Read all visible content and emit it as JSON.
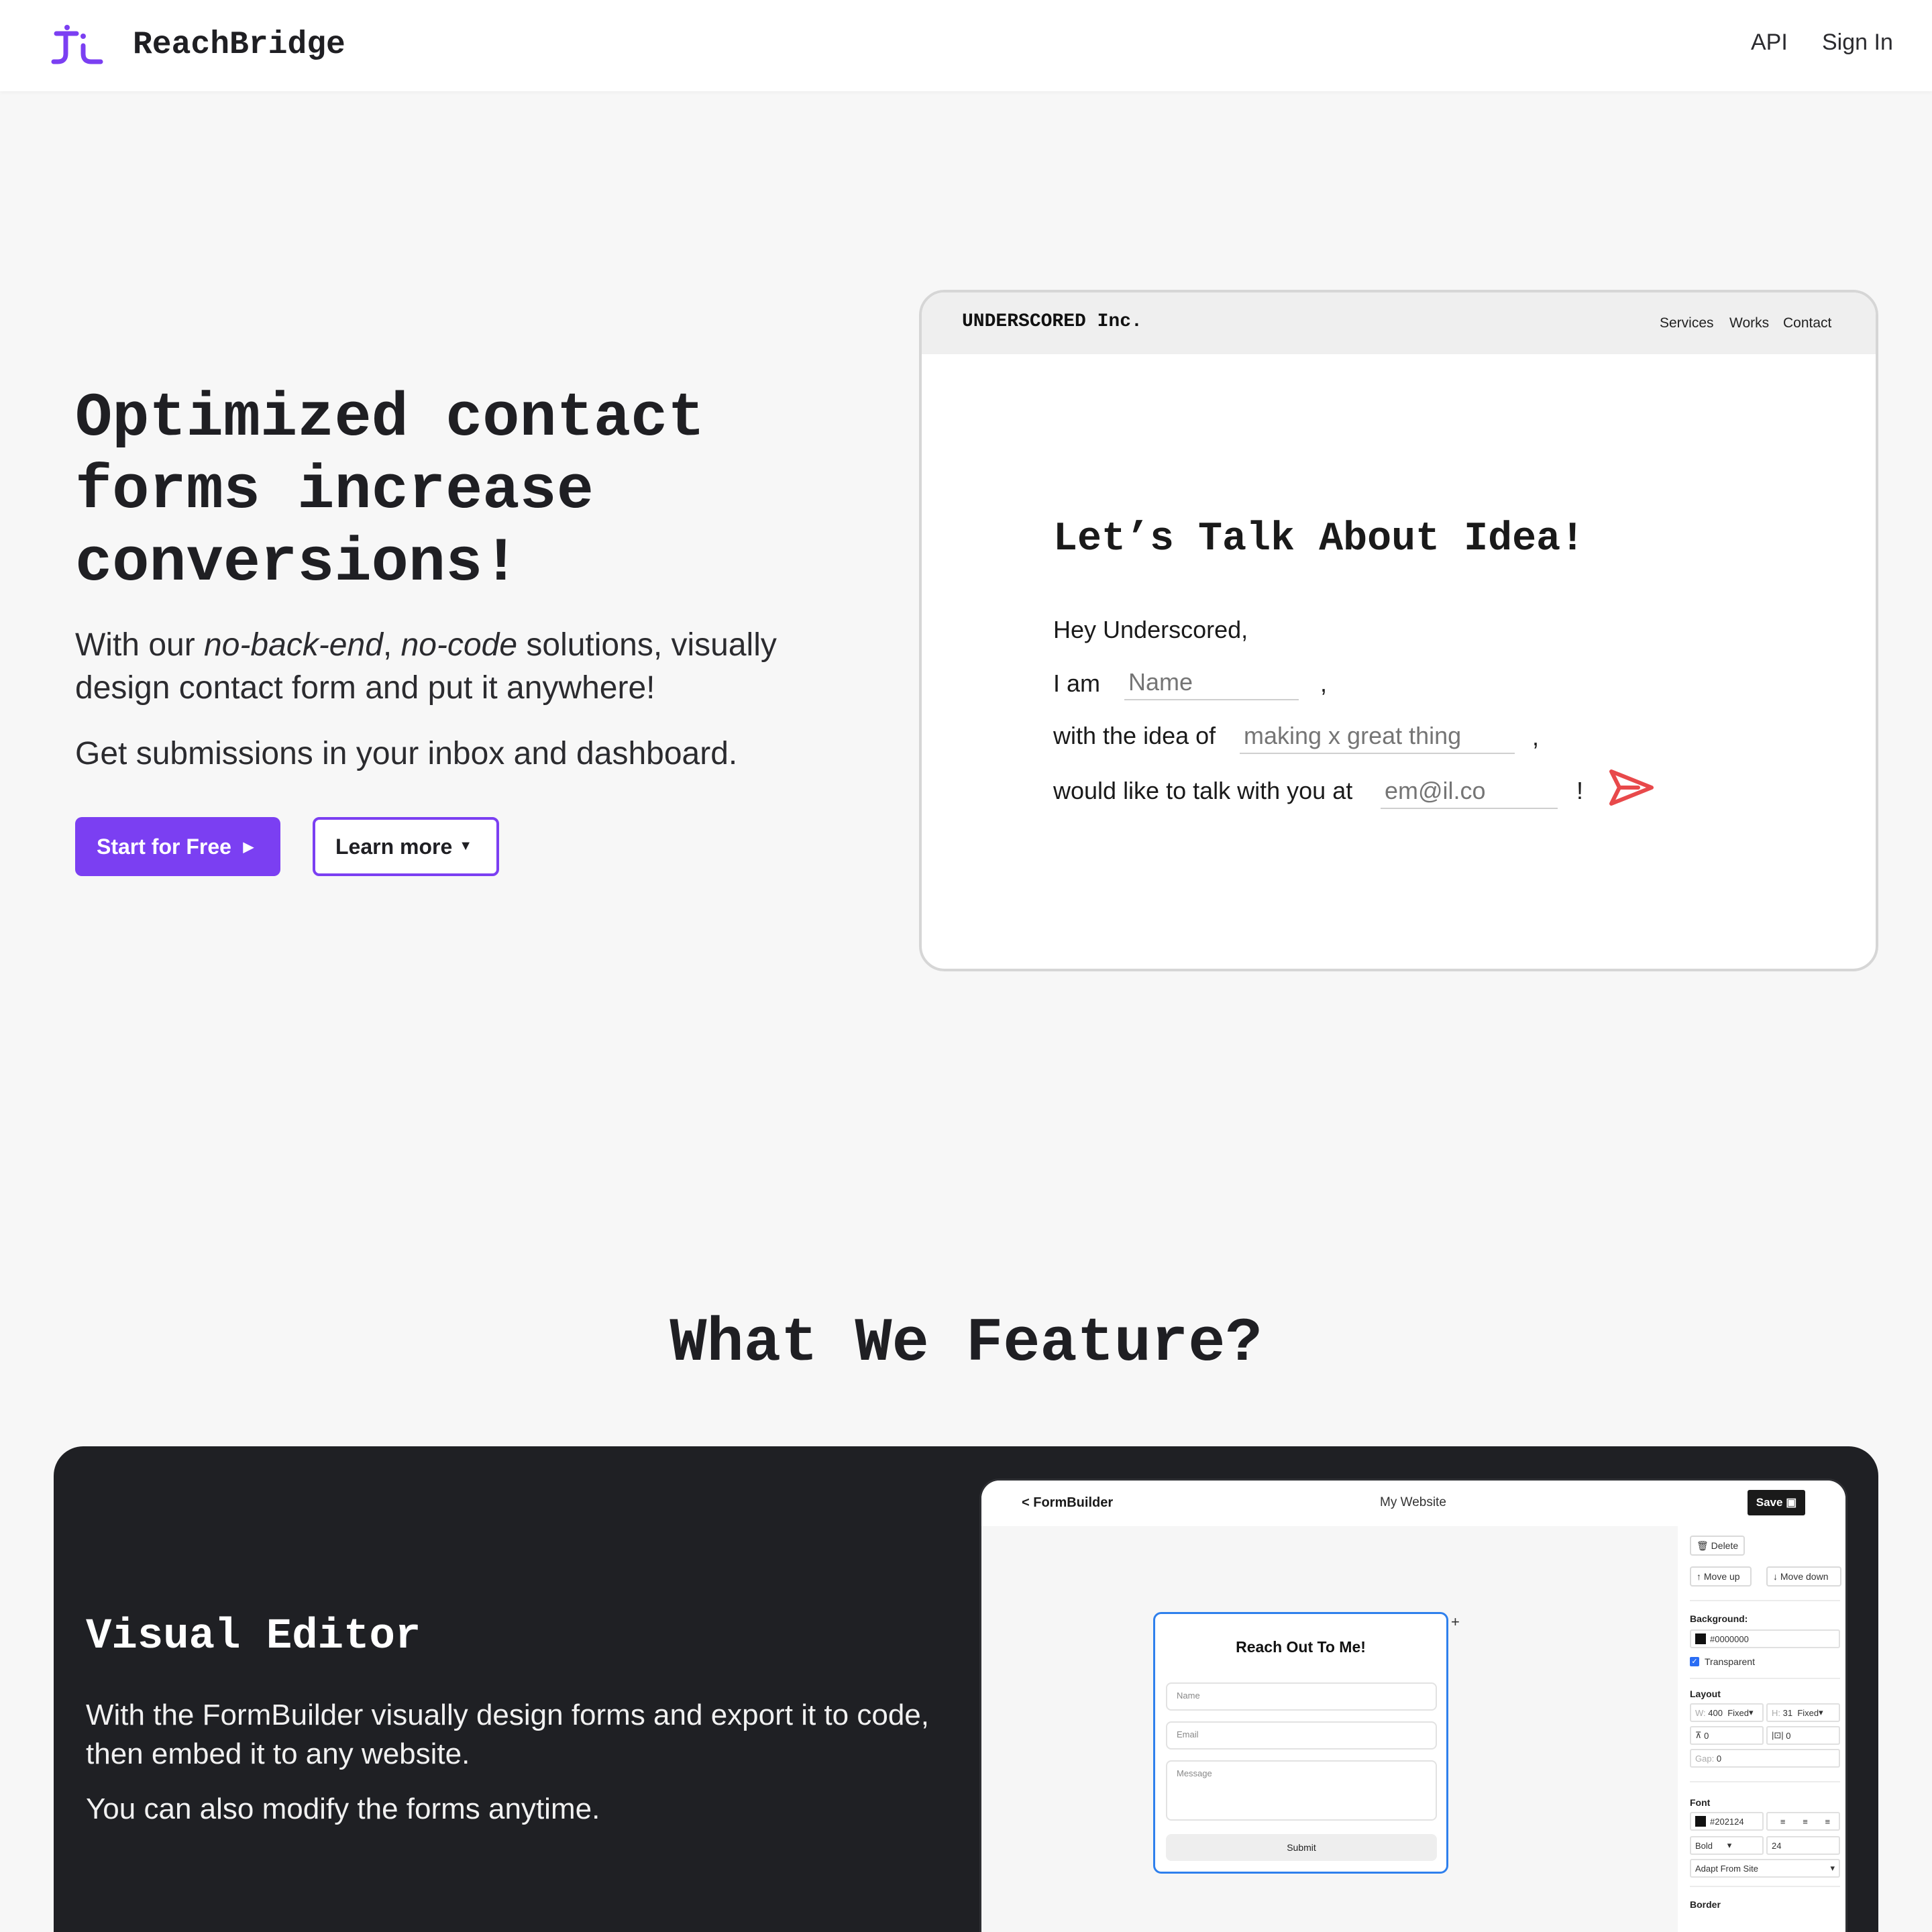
{
  "nav": {
    "brand": "ReachBridge",
    "links": [
      {
        "label": "API"
      },
      {
        "label": "Sign In"
      }
    ],
    "accent_color": "#7b3ff2"
  },
  "hero": {
    "title_lines": [
      "Optimized contact",
      "forms increase",
      "conversions!"
    ],
    "subtitle_parts": {
      "prefix": "With our ",
      "em1": "no-back-end",
      "comma": ", ",
      "em2": "no-code",
      "suffix": " solutions, visually design contact form and put it anywhere!"
    },
    "subtitle2": "Get submissions in your inbox and dashboard.",
    "primary_button": "Start for Free",
    "secondary_button": "Learn more"
  },
  "preview": {
    "brand": "UNDERSCORED Inc.",
    "links": [
      "Services",
      "Works",
      "Contact"
    ],
    "heading": "Let’s Talk About Idea!",
    "greeting": "Hey Underscored,",
    "line1_prefix": "I am",
    "line1_placeholder": "Name",
    "line1_suffix": ",",
    "line2_prefix": "with the idea of",
    "line2_placeholder": "making x great thing",
    "line2_suffix": ",",
    "line3_prefix": "would like to talk with you at",
    "line3_placeholder": "em@il.co",
    "line3_suffix": "!",
    "send_color": "#e8494b"
  },
  "features": {
    "title": "What We Feature?",
    "card": {
      "title": "Visual Editor",
      "text1": "With the FormBuilder visually design forms and export it to code, then embed it to any website.",
      "text2": "You can also modify the forms anytime."
    }
  },
  "formbuilder": {
    "back": "< FormBuilder",
    "site": "My Website",
    "save": "Save",
    "form_title": "Reach Out To Me!",
    "name_placeholder": "Name",
    "email_placeholder": "Email",
    "message_placeholder": "Message",
    "submit": "Submit",
    "panel": {
      "delete": "Delete",
      "move_up": "Move up",
      "move_down": "Move down",
      "background_label": "Background:",
      "background_value": "#0000000",
      "transparent": "Transparent",
      "layout_label": "Layout",
      "w_label": "W:",
      "w_value": "400",
      "w_mode": "Fixed",
      "h_label": "H:",
      "h_value": "31",
      "h_mode": "Fixed",
      "pad_v": "0",
      "pad_h": "0",
      "gap_label": "Gap:",
      "gap_value": "0",
      "font_label": "Font",
      "font_color": "#202124",
      "font_weight": "Bold",
      "font_size": "24",
      "font_family": "Adapt From Site",
      "border_label": "Border"
    }
  }
}
